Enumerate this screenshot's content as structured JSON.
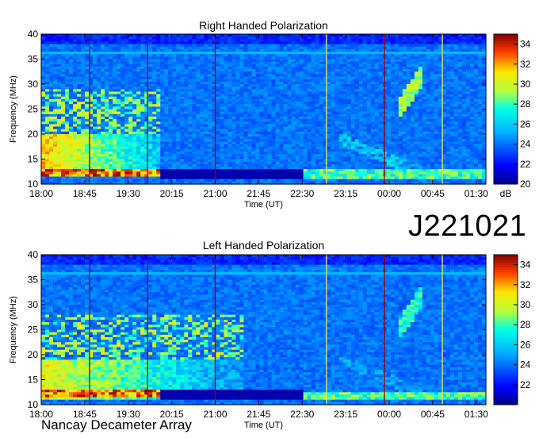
{
  "figure": {
    "event_code": "J221021",
    "footer": "Nancay Decameter Array"
  },
  "chart_data": [
    {
      "type": "heatmap",
      "title": "Right Handed Polarization",
      "xlabel": "Time (UT)",
      "ylabel": "Frequency (MHz)",
      "x_ticks": [
        "18:00",
        "18:45",
        "19:30",
        "20:15",
        "21:00",
        "21:45",
        "22:30",
        "23:15",
        "00:00",
        "00:45",
        "01:30"
      ],
      "x_range": [
        "18:00",
        "01:40"
      ],
      "y_ticks": [
        10,
        15,
        20,
        25,
        30,
        35,
        40
      ],
      "ylim": [
        10,
        40
      ],
      "colorbar": {
        "label": "dB",
        "ticks": [
          20,
          22,
          24,
          26,
          28,
          30,
          32,
          34
        ],
        "range": [
          20,
          35
        ]
      },
      "marker_lines": [
        "18:50",
        "19:50",
        "21:00",
        "22:55",
        "23:55",
        "00:55"
      ],
      "features": [
        {
          "name": "strong low-frequency emission",
          "time": [
            "18:00",
            "20:05"
          ],
          "freq_mhz": [
            12,
            20
          ],
          "level_db": 33
        },
        {
          "name": "drifting arc",
          "time": [
            "23:10",
            "00:35"
          ],
          "freq_mhz": [
            12,
            19
          ],
          "level_db": 27
        },
        {
          "name": "emission band",
          "time": [
            "00:10",
            "00:35"
          ],
          "freq_mhz": [
            25,
            32
          ],
          "level_db": 31
        },
        {
          "name": "steady low band",
          "time": [
            "22:30",
            "01:40"
          ],
          "freq_mhz": [
            11,
            13
          ],
          "level_db": 30
        }
      ]
    },
    {
      "type": "heatmap",
      "title": "Left Handed Polarization",
      "xlabel": "Time (UT)",
      "ylabel": "Frequency (MHz)",
      "x_ticks": [
        "18:00",
        "18:45",
        "19:30",
        "20:15",
        "21:00",
        "21:45",
        "22:30",
        "23:15",
        "00:00",
        "00:45",
        "01:30"
      ],
      "x_range": [
        "18:00",
        "01:40"
      ],
      "y_ticks": [
        10,
        15,
        20,
        25,
        30,
        35,
        40
      ],
      "ylim": [
        10,
        40
      ],
      "colorbar": {
        "label": "",
        "ticks": [
          22,
          24,
          26,
          28,
          30,
          32,
          34
        ],
        "range": [
          20,
          35
        ]
      },
      "marker_lines": [
        "18:50",
        "19:50",
        "21:00",
        "22:55",
        "23:55",
        "00:55"
      ],
      "features": [
        {
          "name": "strong low-frequency emission",
          "time": [
            "18:00",
            "21:30"
          ],
          "freq_mhz": [
            11,
            19
          ],
          "level_db": 32
        },
        {
          "name": "drifting arc",
          "time": [
            "23:10",
            "00:35"
          ],
          "freq_mhz": [
            12,
            19
          ],
          "level_db": 26
        },
        {
          "name": "emission band",
          "time": [
            "00:10",
            "00:35"
          ],
          "freq_mhz": [
            25,
            32
          ],
          "level_db": 29
        },
        {
          "name": "steady low band",
          "time": [
            "22:30",
            "01:40"
          ],
          "freq_mhz": [
            11,
            12.5
          ],
          "level_db": 30
        }
      ]
    }
  ]
}
